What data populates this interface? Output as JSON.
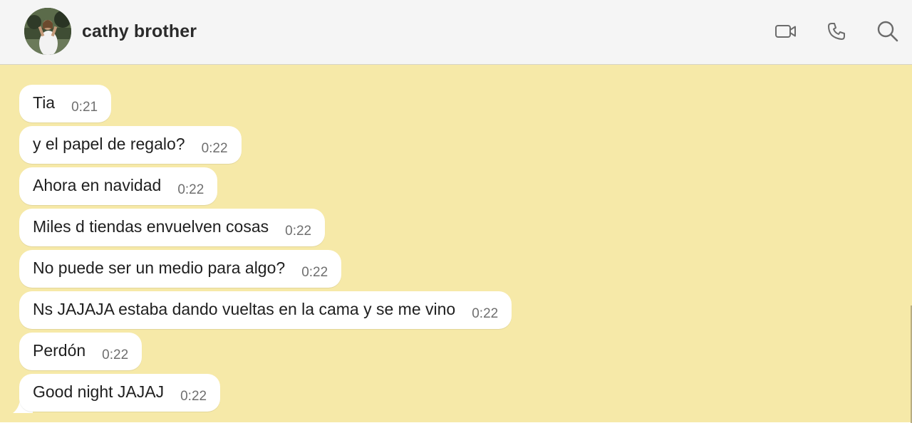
{
  "header": {
    "contact_name": "cathy brother",
    "icons": [
      "video-call-icon",
      "phone-call-icon",
      "search-icon"
    ]
  },
  "messages": [
    {
      "text": "Tia",
      "time": "0:21"
    },
    {
      "text": "y el papel de regalo?",
      "time": "0:22"
    },
    {
      "text": "Ahora en navidad",
      "time": "0:22"
    },
    {
      "text": "Miles d tiendas envuelven cosas",
      "time": "0:22"
    },
    {
      "text": "No puede ser un medio para algo?",
      "time": "0:22"
    },
    {
      "text": "Ns JAJAJA estaba dando vueltas en la cama y se me vino",
      "time": "0:22"
    },
    {
      "text": "Perdón",
      "time": "0:22"
    },
    {
      "text": "Good night JAJAJ",
      "time": "0:22"
    }
  ],
  "colors": {
    "chat_background": "#f6e9a8",
    "header_background": "#f5f5f5",
    "bubble_incoming": "#ffffff",
    "icon_color": "#6b6b6b"
  }
}
